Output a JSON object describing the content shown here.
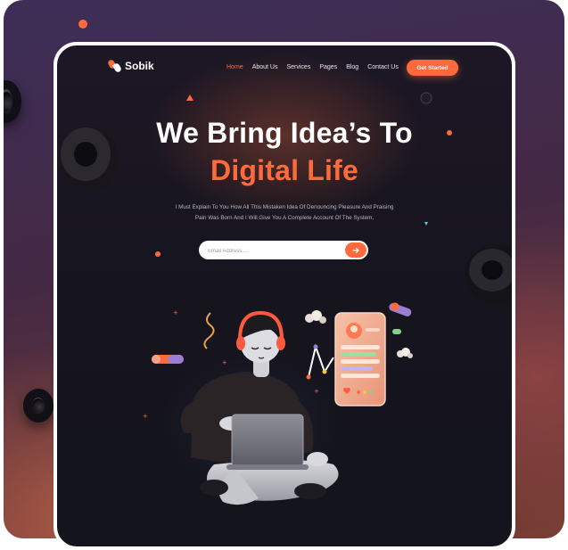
{
  "brand": {
    "name": "Sobik",
    "accent": "#ff6a3d"
  },
  "nav": {
    "items": [
      {
        "label": "Home",
        "active": true
      },
      {
        "label": "About Us",
        "active": false
      },
      {
        "label": "Services",
        "active": false
      },
      {
        "label": "Pages",
        "active": false
      },
      {
        "label": "Blog",
        "active": false
      },
      {
        "label": "Contact Us",
        "active": false
      }
    ],
    "cta_label": "Get Started"
  },
  "hero": {
    "title_line1": "We Bring Idea’s To",
    "title_line2": "Digital Life",
    "subtitle_line1": "I Must Explain To You How All This Mistaken Idea Of Denouncing Pleasure And Praising",
    "subtitle_line2": "Pain Was Born And I Will Give You A Complete Account Of The System,",
    "email_placeholder": "Email Address....",
    "submit_icon": "arrow-right-icon"
  },
  "illustration": {
    "subject": "3d-person-with-laptop-and-phone",
    "accent_colors": [
      "#ff6a3d",
      "#f3a38a",
      "#9b7dd4"
    ]
  }
}
